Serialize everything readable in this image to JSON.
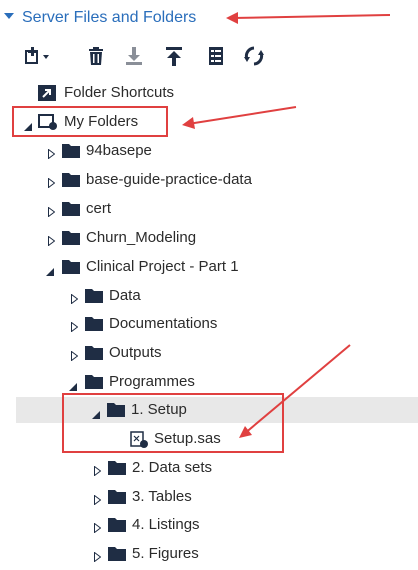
{
  "panel": {
    "title": "Server Files and Folders"
  },
  "toolbar": {
    "buttons": [
      {
        "name": "new-item-icon"
      },
      {
        "name": "delete-icon"
      },
      {
        "name": "download-icon"
      },
      {
        "name": "upload-icon"
      },
      {
        "name": "properties-icon"
      },
      {
        "name": "refresh-icon"
      }
    ]
  },
  "tree": {
    "folder_shortcuts": "Folder Shortcuts",
    "my_folders": "My Folders",
    "items": [
      {
        "label": "94basepe"
      },
      {
        "label": "base-guide-practice-data"
      },
      {
        "label": "cert"
      },
      {
        "label": "Churn_Modeling"
      },
      {
        "label": "Clinical Project - Part 1"
      },
      {
        "label": "Data"
      },
      {
        "label": "Documentations"
      },
      {
        "label": "Outputs"
      },
      {
        "label": "Programmes"
      },
      {
        "label": "1. Setup"
      },
      {
        "label": "Setup.sas"
      },
      {
        "label": "2. Data sets"
      },
      {
        "label": "3. Tables"
      },
      {
        "label": "4. Listings"
      },
      {
        "label": "5. Figures"
      }
    ]
  },
  "colors": {
    "accent": "#2a6ebb",
    "annotation": "#e04040",
    "selected_row": "#e8e8e8",
    "folder": "#1f2d44"
  }
}
